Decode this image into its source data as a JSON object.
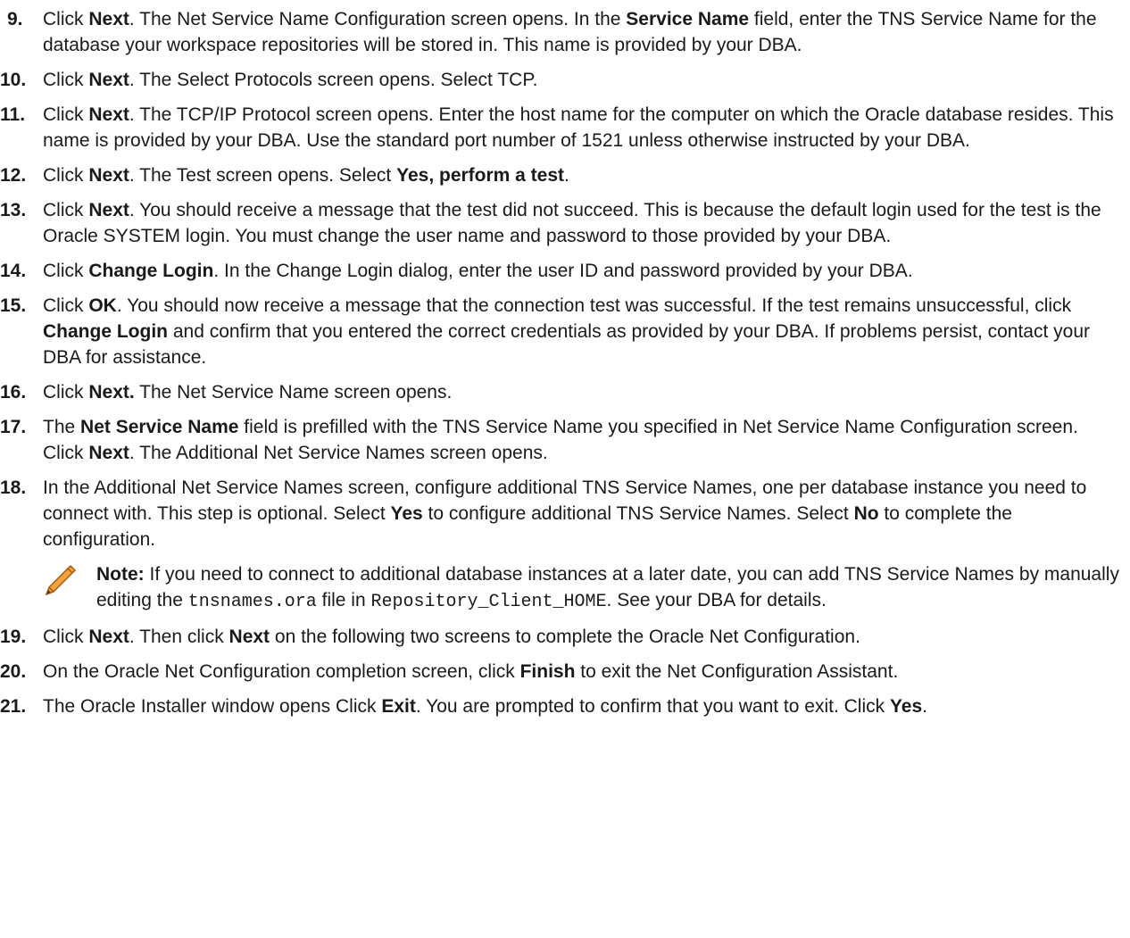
{
  "steps": [
    {
      "num": "9.",
      "parts": [
        {
          "t": "Click "
        },
        {
          "b": "Next"
        },
        {
          "t": ". The Net Service Name Configuration screen opens. In the "
        },
        {
          "b": "Service Name"
        },
        {
          "t": " field, enter the TNS Service Name for the database your workspace repositories will be stored in. This name is provided by your DBA."
        }
      ]
    },
    {
      "num": "10.",
      "parts": [
        {
          "t": "Click "
        },
        {
          "b": "Next"
        },
        {
          "t": ". The Select Protocols screen opens. Select TCP."
        }
      ]
    },
    {
      "num": "11.",
      "parts": [
        {
          "t": "Click "
        },
        {
          "b": "Next"
        },
        {
          "t": ". The TCP/IP Protocol screen opens. Enter the host name for the computer on which the Oracle database resides. This name is provided by your DBA. Use the standard port number of 1521 unless otherwise instructed by your DBA."
        }
      ]
    },
    {
      "num": "12.",
      "parts": [
        {
          "t": "Click "
        },
        {
          "b": "Next"
        },
        {
          "t": ". The Test screen opens. Select "
        },
        {
          "b": "Yes, perform a test"
        },
        {
          "t": "."
        }
      ]
    },
    {
      "num": "13.",
      "parts": [
        {
          "t": "Click "
        },
        {
          "b": "Next"
        },
        {
          "t": ". You should receive a message that the test did not succeed. This is because the default login used for the test is the Oracle SYSTEM login. You must change the user name and password to those provided by your DBA."
        }
      ]
    },
    {
      "num": "14.",
      "parts": [
        {
          "t": "Click "
        },
        {
          "b": "Change Login"
        },
        {
          "t": ". In the Change Login dialog, enter the user ID and password provided by your DBA."
        }
      ]
    },
    {
      "num": "15.",
      "parts": [
        {
          "t": "Click "
        },
        {
          "b": "OK"
        },
        {
          "t": ". You should now receive a message that the connection test was successful. If the test remains unsuccessful, click "
        },
        {
          "b": "Change Login"
        },
        {
          "t": " and confirm that you entered the correct credentials as provided by your DBA. If problems persist, contact your DBA for assistance."
        }
      ]
    },
    {
      "num": "16.",
      "parts": [
        {
          "t": "Click "
        },
        {
          "b": "Next."
        },
        {
          "t": " The Net Service Name screen opens."
        }
      ]
    },
    {
      "num": "17.",
      "parts": [
        {
          "t": "The "
        },
        {
          "b": "Net Service Name"
        },
        {
          "t": " field is prefilled with the TNS Service Name you specified in Net Service Name Configuration screen. Click "
        },
        {
          "b": "Next"
        },
        {
          "t": ". The Additional Net Service Names screen opens."
        }
      ]
    },
    {
      "num": "18.",
      "parts": [
        {
          "t": "In the Additional Net Service Names screen, configure additional TNS Service Names, one per database instance you need to connect with. This step is optional. Select "
        },
        {
          "b": "Yes"
        },
        {
          "t": " to configure additional TNS Service Names. Select "
        },
        {
          "b": "No"
        },
        {
          "t": " to complete the configuration."
        }
      ],
      "note": {
        "icon": "pencil-icon",
        "parts": [
          {
            "b": "Note:"
          },
          {
            "t": " If you need to connect to additional database instances at a later date, you can add TNS Service Names by manually editing the "
          },
          {
            "c": "tnsnames.ora"
          },
          {
            "t": " file in "
          },
          {
            "c": "Repository_Client_HOME"
          },
          {
            "t": ". See your DBA for details."
          }
        ]
      }
    },
    {
      "num": "19.",
      "parts": [
        {
          "t": "Click "
        },
        {
          "b": "Next"
        },
        {
          "t": ". Then click "
        },
        {
          "b": "Next"
        },
        {
          "t": " on the following two screens to complete the Oracle Net Configuration."
        }
      ]
    },
    {
      "num": "20.",
      "parts": [
        {
          "t": "On the Oracle Net Configuration completion screen, click "
        },
        {
          "b": "Finish"
        },
        {
          "t": " to exit the Net Configuration Assistant."
        }
      ]
    },
    {
      "num": "21.",
      "parts": [
        {
          "t": "The Oracle Installer window opens Click "
        },
        {
          "b": "Exit"
        },
        {
          "t": ". You are prompted to confirm that you want to exit. Click "
        },
        {
          "b": "Yes"
        },
        {
          "t": "."
        }
      ]
    }
  ],
  "colors": {
    "pencil_fill": "#f2a33a",
    "pencil_stroke": "#a85a12",
    "text": "#1a1a1a"
  }
}
